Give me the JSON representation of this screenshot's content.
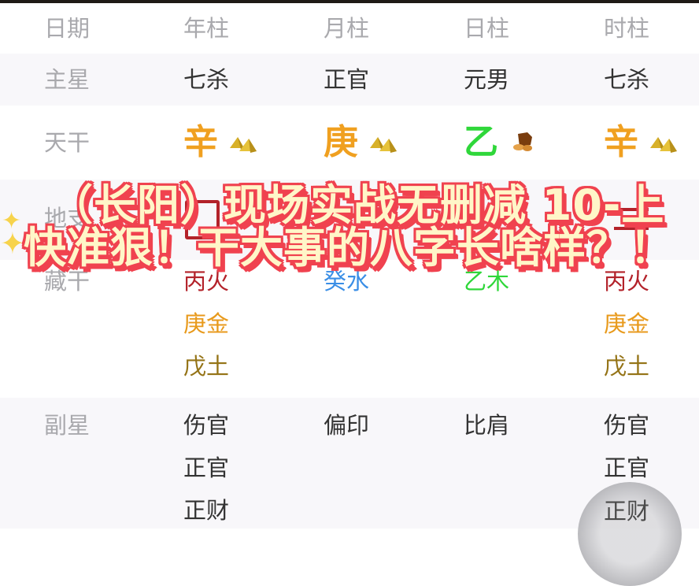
{
  "header": {
    "label": "日期",
    "columns": [
      "年柱",
      "月柱",
      "日柱",
      "时柱"
    ]
  },
  "rows": {
    "main_star": {
      "label": "主星",
      "values": [
        "七杀",
        "正官",
        "元男",
        "七杀"
      ]
    },
    "heavenly_stem": {
      "label": "天干",
      "values": [
        {
          "char": "辛",
          "element": "metal",
          "color": "#f0a020",
          "icon": "gold-pyramid-icon"
        },
        {
          "char": "庚",
          "element": "metal",
          "color": "#f0a020",
          "icon": "gold-pyramid-icon"
        },
        {
          "char": "乙",
          "element": "wood",
          "color": "#2fd73a",
          "icon": "wood-log-icon"
        },
        {
          "char": "辛",
          "element": "metal",
          "color": "#f0a020",
          "icon": "gold-pyramid-icon"
        }
      ]
    },
    "earthly_branch": {
      "label": "地支"
    },
    "hidden_stems": {
      "label": "藏干",
      "columns": [
        [
          "丙火",
          "庚金",
          "戊土"
        ],
        [
          "癸水"
        ],
        [
          "乙木"
        ],
        [
          "丙火",
          "庚金",
          "戊土"
        ]
      ]
    },
    "sub_star": {
      "label": "副星",
      "columns": [
        [
          "伤官",
          "正官",
          "正财"
        ],
        [
          "偏印"
        ],
        [
          "比肩"
        ],
        [
          "伤官",
          "正官",
          "正财"
        ]
      ]
    }
  },
  "overlay_title": {
    "line1": "（长阳）现场实战无删减 10-上",
    "line2": "快准狠！干大事的八字长啥样？！"
  },
  "colors": {
    "fire": "#b3222a",
    "metal": "#e89a1c",
    "earth": "#947316",
    "water": "#3a8ee6",
    "wood": "#2fd73a",
    "overlay_stroke": "#f0424f",
    "overlay_fill": "#fff1b8"
  }
}
